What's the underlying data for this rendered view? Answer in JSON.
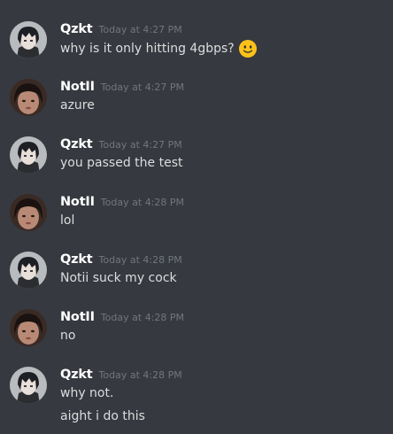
{
  "messages": [
    {
      "author": "Qzkt",
      "avatar_icon": "anime-avatar-icon",
      "timestamp": "Today at 4:27 PM",
      "lines": [
        "why is it only hitting 4gbps?"
      ],
      "emoji": "slightly-smiling-face-icon"
    },
    {
      "author": "NotII",
      "avatar_icon": "photo-avatar-icon",
      "timestamp": "Today at 4:27 PM",
      "lines": [
        "azure"
      ]
    },
    {
      "author": "Qzkt",
      "avatar_icon": "anime-avatar-icon",
      "timestamp": "Today at 4:27 PM",
      "lines": [
        "you passed the test"
      ]
    },
    {
      "author": "NotII",
      "avatar_icon": "photo-avatar-icon",
      "timestamp": "Today at 4:28 PM",
      "lines": [
        "lol"
      ]
    },
    {
      "author": "Qzkt",
      "avatar_icon": "anime-avatar-icon",
      "timestamp": "Today at 4:28 PM",
      "lines": [
        "Notii suck my cock"
      ]
    },
    {
      "author": "NotII",
      "avatar_icon": "photo-avatar-icon",
      "timestamp": "Today at 4:28 PM",
      "lines": [
        "no"
      ]
    },
    {
      "author": "Qzkt",
      "avatar_icon": "anime-avatar-icon",
      "timestamp": "Today at 4:28 PM",
      "lines": [
        "why not.",
        "aight i do this"
      ]
    }
  ],
  "colors": {
    "background": "#36393f",
    "username": "#ffffff",
    "timestamp": "#72767d",
    "message_text": "#dcddde"
  }
}
